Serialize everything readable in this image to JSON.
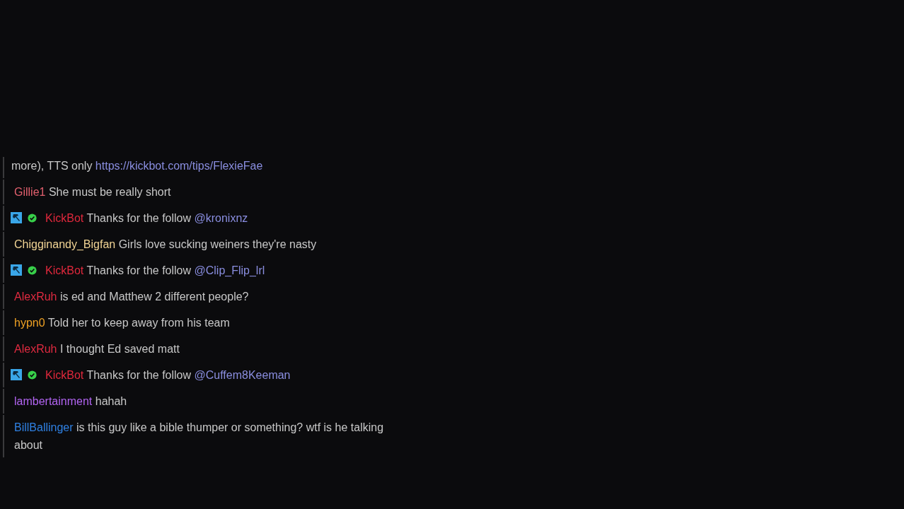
{
  "messages": [
    {
      "kind": "continuation",
      "text": "more), TTS only",
      "link": "https://kickbot.com/tips/FlexieFae"
    },
    {
      "kind": "user",
      "user": "Gillie1",
      "color": "#e2606e",
      "text": "She must be really short"
    },
    {
      "kind": "bot",
      "user": "KickBot",
      "color": "#e0283c",
      "text": "Thanks for the follow",
      "mention": "@kronixnz"
    },
    {
      "kind": "user",
      "user": "Chigginandy_Bigfan",
      "color": "#f0d394",
      "text": "Girls love sucking weiners they're nasty"
    },
    {
      "kind": "bot",
      "user": "KickBot",
      "color": "#e0283c",
      "text": "Thanks for the follow",
      "mention": "@Clip_Flip_lrl"
    },
    {
      "kind": "user",
      "user": "AlexRuh",
      "color": "#e02a40",
      "text": "is ed and Matthew 2 different people?"
    },
    {
      "kind": "user",
      "user": "hypn0",
      "color": "#f0a224",
      "text": "Told her to keep away from his team"
    },
    {
      "kind": "user",
      "user": "AlexRuh",
      "color": "#e02a40",
      "text": "I thought Ed saved matt"
    },
    {
      "kind": "bot",
      "user": "KickBot",
      "color": "#e0283c",
      "text": "Thanks for the follow",
      "mention": "@Cuffem8Keeman"
    },
    {
      "kind": "user",
      "user": "lambertainment",
      "color": "#b264f2",
      "text": "hahah"
    },
    {
      "kind": "user",
      "user": "BillBallinger",
      "color": "#2f80e2",
      "text": "is this guy like a bible thumper or something? wtf is he talking about"
    }
  ]
}
